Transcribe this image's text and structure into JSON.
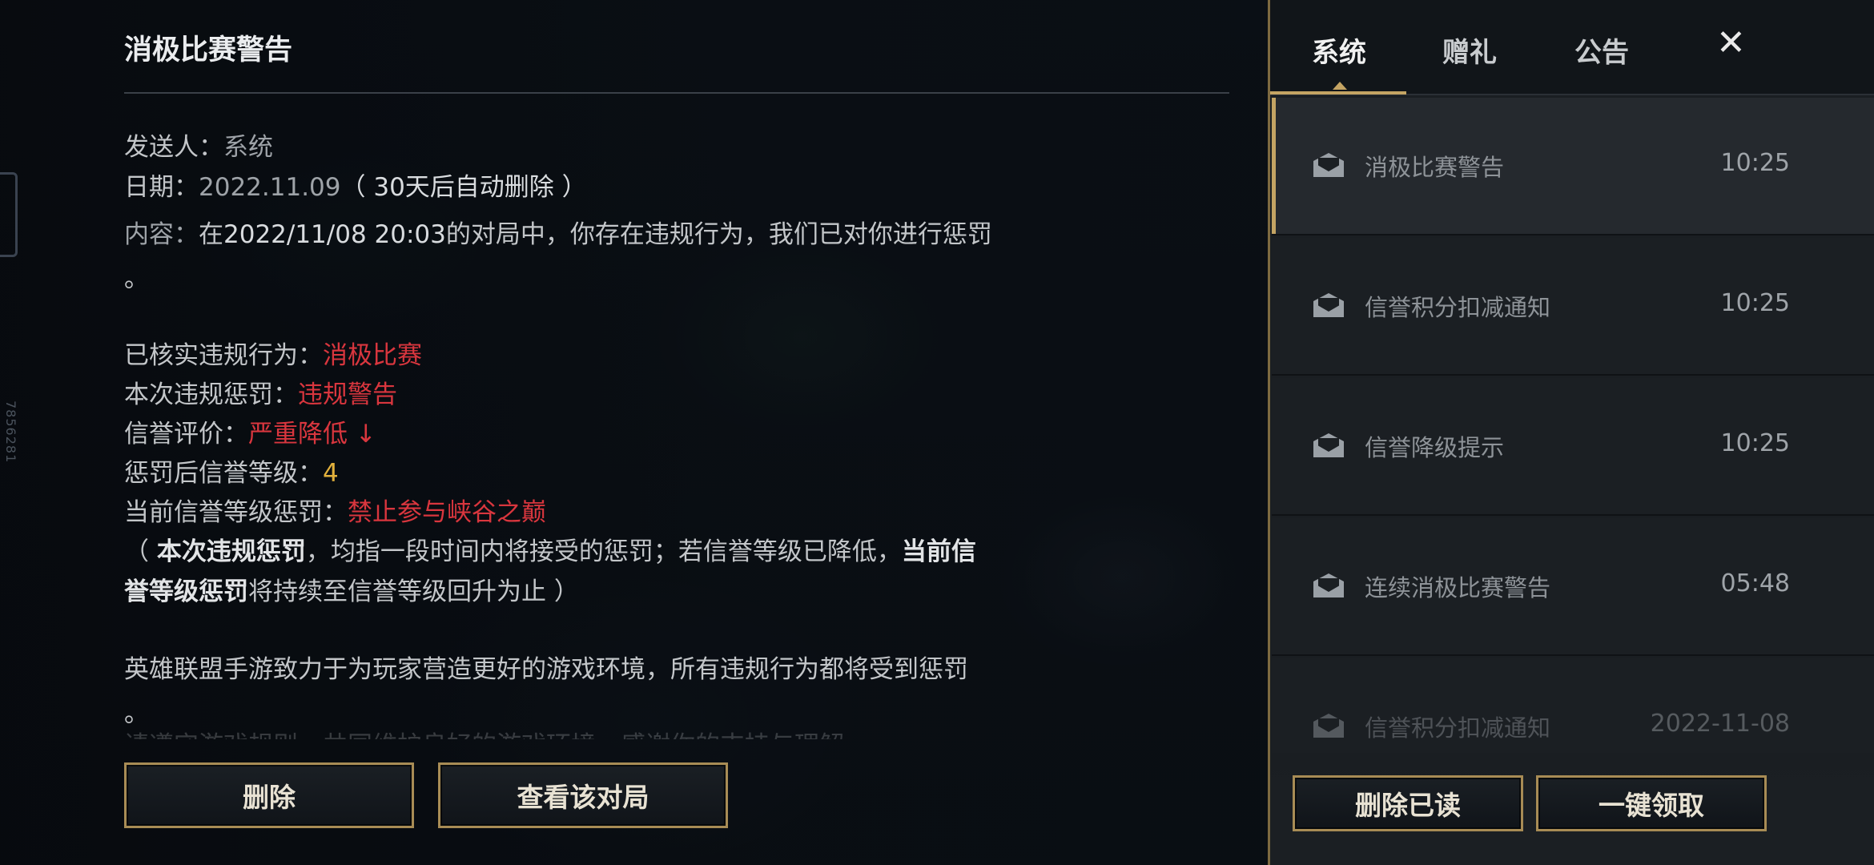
{
  "detail": {
    "title": "消极比赛警告",
    "sender_label": "发送人：",
    "sender_value": "系统",
    "date_label": "日期：",
    "date_value": "2022.11.09",
    "date_note": "（ 30天后自动删除 ）",
    "content_label": "内容：",
    "content_prefix": "在",
    "content_datetime": "2022/11/08 20:03",
    "content_rest": "的对局中，你存在违规行为，我们已对你进行惩罚",
    "content_end": "。",
    "violation_label": "已核实违规行为：",
    "violation_value": "消极比赛",
    "penalty_label": "本次违规惩罚：",
    "penalty_value": "违规警告",
    "credit_label": "信誉评价：",
    "credit_value": "严重降低 ↓",
    "level_label": "惩罚后信誉等级：",
    "level_value": "4",
    "level_penalty_label": "当前信誉等级惩罚：",
    "level_penalty_value": "禁止参与峡谷之巅",
    "note_open": "（ ",
    "note_bold1": "本次违规惩罚",
    "note_mid": "，均指一段时间内将接受的惩罚；若信誉等级已降低，",
    "note_bold2a": "当前信",
    "note_bold2b": "誉等级惩罚",
    "note_end": "将持续至信誉等级回升为止 ）",
    "closing": "英雄联盟手游致力于为玩家营造更好的游戏环境，所有违规行为都将受到惩罚",
    "closing_end": "。",
    "closing_cut": "请遵守游戏规则，共同维护良好的游戏环境，感谢你的支持与理解。"
  },
  "buttons": {
    "delete": "删除",
    "view_match": "查看该对局",
    "delete_read": "删除已读",
    "claim_all": "一键领取"
  },
  "tabs": [
    {
      "label": "系统",
      "active": true
    },
    {
      "label": "赠礼",
      "active": false
    },
    {
      "label": "公告",
      "active": false
    }
  ],
  "close_glyph": "✕",
  "side_id": "7856281",
  "mails": [
    {
      "subject": "消极比赛警告",
      "time": "10:25",
      "selected": true
    },
    {
      "subject": "信誉积分扣减通知",
      "time": "10:25",
      "selected": false
    },
    {
      "subject": "信誉降级提示",
      "time": "10:25",
      "selected": false
    },
    {
      "subject": "连续消极比赛警告",
      "time": "05:48",
      "selected": false
    },
    {
      "subject": "信誉积分扣减通知",
      "time": "2022-11-08",
      "selected": false
    }
  ],
  "icons": {
    "mail": "open-envelope-icon",
    "close": "close-icon"
  },
  "colors": {
    "accent_gold": "#c4a463",
    "penalty_red": "#d9363e",
    "level_gold": "#e2b13c"
  }
}
